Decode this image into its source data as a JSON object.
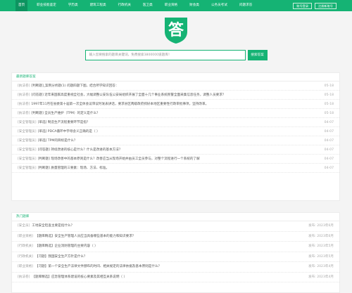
{
  "nav": {
    "items": [
      "首页",
      "职业技能鉴定",
      "学历类",
      "建筑工程类",
      "行政机关",
      "医卫类",
      "职业资格",
      "财会类",
      "公务员考试",
      "问题求答"
    ],
    "buttons": [
      "账号登录",
      "注册新账号"
    ]
  },
  "logo": {
    "glyph": "答"
  },
  "search": {
    "placeholder": "输入您要搜索的题目关键词，免费搜索3800000道题库！",
    "button": "搜索答案"
  },
  "latest": {
    "heading": "最新题库答案",
    "rows": [
      {
        "tag": "[执法卷]",
        "title": "[判断题]_案例分析题(1) 问题四题下图，结合所学知识回答：",
        "date": "05-18"
      },
      {
        "tag": "[执法卷]",
        "title": "[问答题] 近年来国家高度重视全社会，大幅调整公安队伍公安局组织开展了全面十几个事业系统民警全面采集信息任务，调整人员要求？",
        "date": "05-18"
      },
      {
        "tag": "[执法卷]",
        "title": "1997年11月在省委第十届第一次全体会议审议时发表讲话，要求县区两级政府抓好本地区重要性行政审批事项，坚持改革。",
        "date": "05-18"
      },
      {
        "tag": "[执法卷]",
        "title": "[判断题] 全员生产维护（TPM）的定义是什么？",
        "date": "05-18"
      },
      {
        "tag": "[安全管理员]",
        "title": "[单选] 制造生产流程重要环节是指？",
        "date": "04-07"
      },
      {
        "tag": "[安全管理员]",
        "title": "[单选] PDCA循环中字母含义正确的是（ ）",
        "date": "04-07"
      },
      {
        "tag": "[安全管理员]",
        "title": "[单选] TPM的目标是什么？",
        "date": "04-07"
      },
      {
        "tag": "[安全管理员]",
        "title": "[问答题] 持续改进的核心是什么？什么是改进的基本方法？",
        "date": "04-07"
      },
      {
        "tag": "[安全管理员]",
        "title": "[判断题] 现场改善中的基本原则是什么？改善应当从现场开始并由员工全员参与，对整个流程进行一个系统的了解",
        "date": "04-07"
      },
      {
        "tag": "[安全管理员]",
        "title": "[判断题] 质量管理的三要素：现场、方法、标准。",
        "date": "04-07"
      }
    ]
  },
  "hot": {
    "heading": "热门题库",
    "rows": [
      {
        "tag": "[安全员]",
        "title": "工地安全检查主要是指什么？",
        "date": "发布: 2023年6月"
      },
      {
        "tag": "[职业资格]",
        "title": "【题库精选】安全生产管理人员应当具备哪些基本的能力和知识要求？",
        "date": "发布: 2023年6月"
      },
      {
        "tag": "[行政机关]",
        "title": "【题库精选】企业消防管理的主要内容（ ）",
        "date": "发布: 2023年5月"
      },
      {
        "tag": "[行政机关]",
        "title": "【习题】我国安全生产方针是什么？",
        "date": "发布: 2023年5月"
      },
      {
        "tag": "[职业资格]",
        "title": "【习题】第一个安全生产法律文件颁布的时间、相关规定的法律依据及基本原则是什么？",
        "date": "发布: 2023年4月"
      },
      {
        "tag": "[执法卷]",
        "title": "【题库精选】应急管理体系建设的核心要素及其相互关系说明（ ）",
        "date": "发布: 2023年4月"
      }
    ]
  }
}
